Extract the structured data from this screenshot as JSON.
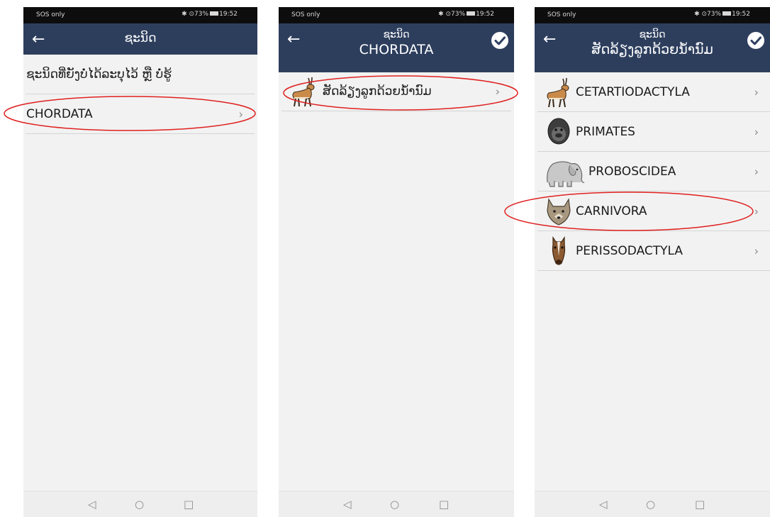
{
  "status": {
    "left": "SOS only",
    "right": "✱ ⊙73%",
    "time": "19:52"
  },
  "highlight_color": "#e02020",
  "appbar_color": "#2d3e5d",
  "screen1": {
    "title": "ຊະນິດ",
    "items": [
      {
        "label": "ຊະນິດທີ່ຍັງບໍ່ໄດ້ລະບຸໄວ້ ຫຼື ບໍ່ຮູ້"
      },
      {
        "label": "CHORDATA"
      }
    ]
  },
  "screen2": {
    "title": "ຊະນິດ",
    "subtitle": "CHORDATA",
    "items": [
      {
        "label": "ສັດລ້ຽງລູກດ້ວຍນ້ຳນົມ",
        "icon": "antelope-icon"
      }
    ]
  },
  "screen3": {
    "title": "ຊະນິດ",
    "subtitle": "ສັດລ້ຽງລູກດ້ວຍນ້ຳນົມ",
    "items": [
      {
        "label": "CETARTIODACTYLA",
        "icon": "antelope-icon"
      },
      {
        "label": "PRIMATES",
        "icon": "gorilla-icon"
      },
      {
        "label": "PROBOSCIDEA",
        "icon": "elephant-icon"
      },
      {
        "label": "CARNIVORA",
        "icon": "wolf-icon"
      },
      {
        "label": "PERISSODACTYLA",
        "icon": "horse-icon"
      }
    ]
  },
  "navbar": {
    "back": "◁",
    "home": "○",
    "recents": "□"
  }
}
